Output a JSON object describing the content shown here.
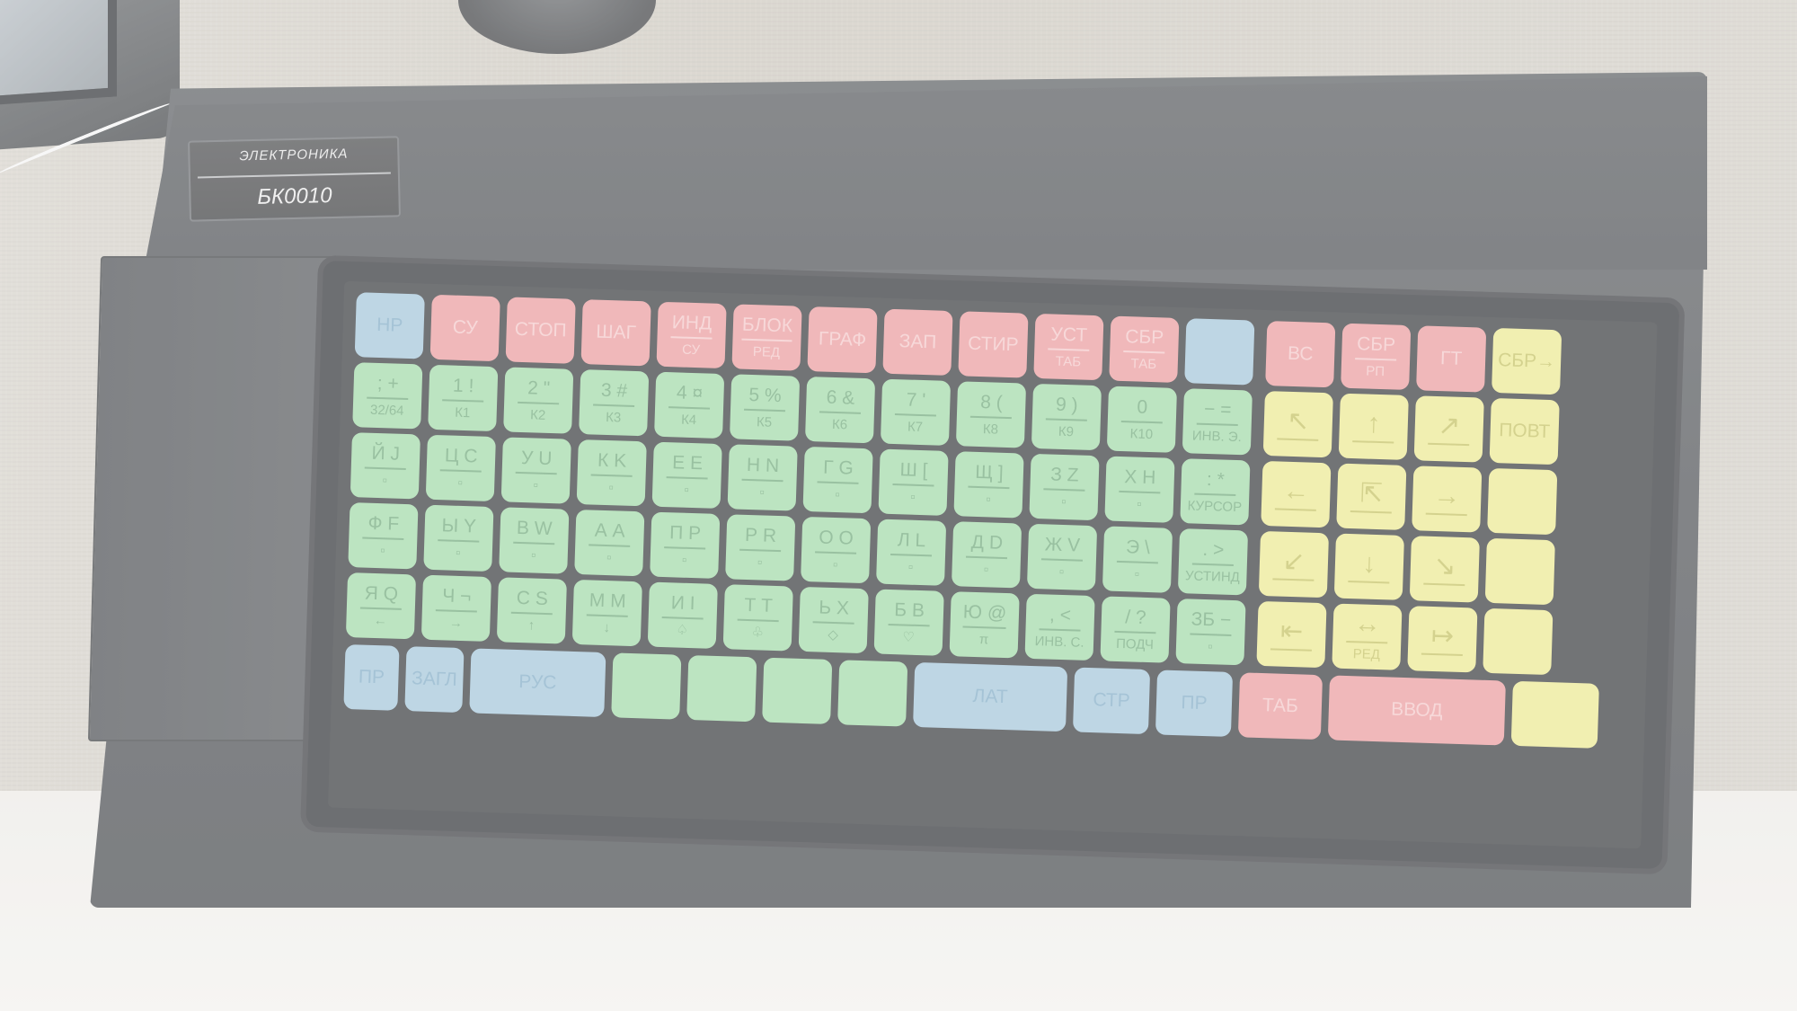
{
  "device": {
    "brand": "ЭЛЕКТРОНИКА",
    "model": "БК0010"
  },
  "colors": {
    "blue": "#a2c5d9",
    "red": "#ea9a9c",
    "green": "#9fd9a6",
    "yellow": "#ebe890",
    "case": "#4d5054"
  },
  "keys": {
    "r0": [
      {
        "c": "blue",
        "m": "НР"
      },
      {
        "c": "red",
        "m": "СУ"
      },
      {
        "c": "red",
        "m": "СТОП"
      },
      {
        "c": "red",
        "m": "ШАГ"
      },
      {
        "c": "red",
        "m": "ИНД",
        "s": "СУ"
      },
      {
        "c": "red",
        "m": "БЛОК",
        "s": "РЕД"
      },
      {
        "c": "red",
        "m": "ГРАФ"
      },
      {
        "c": "red",
        "m": "ЗАП"
      },
      {
        "c": "red",
        "m": "СТИР"
      },
      {
        "c": "red",
        "m": "УСТ",
        "s": "ТАБ"
      },
      {
        "c": "red",
        "m": "СБР",
        "s": "ТАБ"
      },
      {
        "c": "blue",
        "m": ""
      },
      {
        "c": "red",
        "m": "ВС"
      },
      {
        "c": "red",
        "m": "СБР",
        "s": "РП"
      },
      {
        "c": "red",
        "m": "ГТ"
      },
      {
        "c": "yellow",
        "m": "СБР→"
      }
    ],
    "r1": [
      {
        "c": "green",
        "m": "; +",
        "s": "32/64"
      },
      {
        "c": "green",
        "m": "1 !",
        "s": "К1"
      },
      {
        "c": "green",
        "m": "2 \"",
        "s": "К2"
      },
      {
        "c": "green",
        "m": "3 #",
        "s": "К3"
      },
      {
        "c": "green",
        "m": "4 ¤",
        "s": "К4"
      },
      {
        "c": "green",
        "m": "5 %",
        "s": "К5"
      },
      {
        "c": "green",
        "m": "6 &",
        "s": "К6"
      },
      {
        "c": "green",
        "m": "7 '",
        "s": "К7"
      },
      {
        "c": "green",
        "m": "8 (",
        "s": "К8"
      },
      {
        "c": "green",
        "m": "9 )",
        "s": "К9"
      },
      {
        "c": "green",
        "m": "0",
        "s": "К10"
      },
      {
        "c": "green",
        "m": "− =",
        "s": "ИНВ. Э."
      },
      {
        "c": "yellow",
        "m": "↖"
      },
      {
        "c": "yellow",
        "m": "↑"
      },
      {
        "c": "yellow",
        "m": "↗"
      },
      {
        "c": "yellow",
        "m": "ПОВТ"
      }
    ],
    "r2": [
      {
        "c": "green",
        "m": "Й J",
        "s": "▫"
      },
      {
        "c": "green",
        "m": "Ц C",
        "s": "▫"
      },
      {
        "c": "green",
        "m": "У U",
        "s": "▫"
      },
      {
        "c": "green",
        "m": "К K",
        "s": "▫"
      },
      {
        "c": "green",
        "m": "Е E",
        "s": "▫"
      },
      {
        "c": "green",
        "m": "Н N",
        "s": "▫"
      },
      {
        "c": "green",
        "m": "Г G",
        "s": "▫"
      },
      {
        "c": "green",
        "m": "Ш [",
        "s": "▫"
      },
      {
        "c": "green",
        "m": "Щ ]",
        "s": "▫"
      },
      {
        "c": "green",
        "m": "З Z",
        "s": "▫"
      },
      {
        "c": "green",
        "m": "Х H",
        "s": "▫"
      },
      {
        "c": "green",
        "m": ": *",
        "s": "КУРСОР"
      },
      {
        "c": "yellow",
        "m": "←"
      },
      {
        "c": "yellow",
        "m": "⇱"
      },
      {
        "c": "yellow",
        "m": "→"
      },
      {
        "c": "yellow",
        "m": ""
      }
    ],
    "r3": [
      {
        "c": "green",
        "m": "Ф F",
        "s": "▫"
      },
      {
        "c": "green",
        "m": "Ы Y",
        "s": "▫"
      },
      {
        "c": "green",
        "m": "В W",
        "s": "▫"
      },
      {
        "c": "green",
        "m": "А A",
        "s": "▫"
      },
      {
        "c": "green",
        "m": "П P",
        "s": "▫"
      },
      {
        "c": "green",
        "m": "Р R",
        "s": "▫"
      },
      {
        "c": "green",
        "m": "О O",
        "s": "▫"
      },
      {
        "c": "green",
        "m": "Л L",
        "s": "▫"
      },
      {
        "c": "green",
        "m": "Д D",
        "s": "▫"
      },
      {
        "c": "green",
        "m": "Ж V",
        "s": "▫"
      },
      {
        "c": "green",
        "m": "Э \\",
        "s": "▫"
      },
      {
        "c": "green",
        "m": ". >",
        "s": "УСТИНД"
      },
      {
        "c": "yellow",
        "m": "↙"
      },
      {
        "c": "yellow",
        "m": "↓"
      },
      {
        "c": "yellow",
        "m": "↘"
      },
      {
        "c": "yellow",
        "m": ""
      }
    ],
    "r4": [
      {
        "c": "green",
        "m": "Я Q",
        "s": "←"
      },
      {
        "c": "green",
        "m": "Ч ¬",
        "s": "→"
      },
      {
        "c": "green",
        "m": "С S",
        "s": "↑"
      },
      {
        "c": "green",
        "m": "М M",
        "s": "↓"
      },
      {
        "c": "green",
        "m": "И I",
        "s": "♤"
      },
      {
        "c": "green",
        "m": "Т T",
        "s": "♧"
      },
      {
        "c": "green",
        "m": "Ь X",
        "s": "◇"
      },
      {
        "c": "green",
        "m": "Б B",
        "s": "♡"
      },
      {
        "c": "green",
        "m": "Ю @",
        "s": "π"
      },
      {
        "c": "green",
        "m": ", <",
        "s": "ИНВ. С."
      },
      {
        "c": "green",
        "m": "/ ?",
        "s": "ПОДЧ"
      },
      {
        "c": "green",
        "m": "ЗБ −",
        "s": "▫"
      },
      {
        "c": "yellow",
        "m": "⇤"
      },
      {
        "c": "yellow",
        "m": "↔",
        "s": "РЕД"
      },
      {
        "c": "yellow",
        "m": "↦"
      },
      {
        "c": "yellow",
        "m": ""
      }
    ],
    "r5": [
      {
        "c": "blue",
        "m": "ПР"
      },
      {
        "c": "blue",
        "m": "ЗАГЛ"
      },
      {
        "c": "blue",
        "m": "РУС"
      },
      {
        "c": "green",
        "m": ""
      },
      {
        "c": "green",
        "m": ""
      },
      {
        "c": "green",
        "m": ""
      },
      {
        "c": "green",
        "m": ""
      },
      {
        "c": "blue",
        "m": "ЛАТ"
      },
      {
        "c": "blue",
        "m": "СТР"
      },
      {
        "c": "blue",
        "m": "ПР"
      },
      {
        "c": "red",
        "m": "ТАБ"
      },
      {
        "c": "red",
        "m": "ВВОД"
      },
      {
        "c": "yellow",
        "m": ""
      }
    ]
  }
}
